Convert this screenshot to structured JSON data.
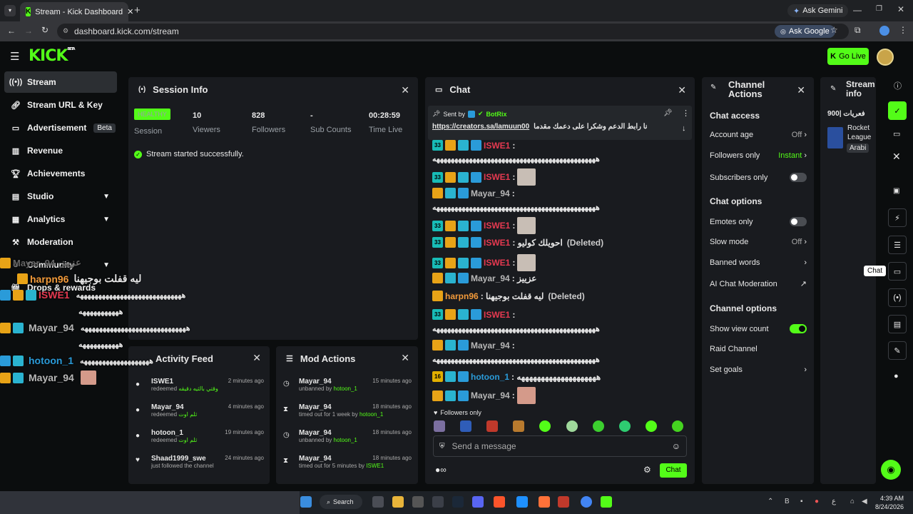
{
  "browser": {
    "tab_title": "Stream - Kick Dashboard",
    "ask_gemini": "Ask Gemini",
    "url": "dashboard.kick.com/stream",
    "ask_google": "Ask Google"
  },
  "header": {
    "logo": "KICK",
    "logo_beta": "BETA",
    "go_live": "Go Live"
  },
  "sidebar": {
    "items": [
      {
        "label": "Stream",
        "icon": "broadcast-icon"
      },
      {
        "label": "Stream URL & Key",
        "icon": "link-icon"
      },
      {
        "label": "Advertisement",
        "icon": "ad-icon",
        "badge": "Beta"
      },
      {
        "label": "Revenue",
        "icon": "chart-icon"
      },
      {
        "label": "Achievements",
        "icon": "trophy-icon"
      },
      {
        "label": "Studio",
        "icon": "studio-icon"
      },
      {
        "label": "Analytics",
        "icon": "analytics-icon"
      },
      {
        "label": "Moderation",
        "icon": "hammer-icon"
      },
      {
        "label": "Community",
        "icon": "community-icon"
      },
      {
        "label": "Drops & rewards",
        "icon": "gift-icon"
      }
    ]
  },
  "session": {
    "title": "Session Info",
    "status": "HEALTHY",
    "status_label": "Session",
    "viewers": "10",
    "viewers_label": "Viewers",
    "followers": "828",
    "followers_label": "Followers",
    "subs": "-",
    "subs_label": "Sub Counts",
    "time": "00:28:59",
    "time_label": "Time Live",
    "message": "Stream started successfully."
  },
  "chat": {
    "title": "Chat",
    "pinned_sent_by": "Sent by",
    "pinned_user": "BotRix",
    "pinned_link": "https://creators.sa/lamuun00",
    "pinned_text": "نا رابط الدعم وشكرا على دعمك مقدما",
    "rows": [
      {
        "user": "ISWE1",
        "text": ":"
      },
      {
        "user": "ISWE1",
        "text": ":"
      },
      {
        "user": "Mayar_94",
        "text": ":"
      },
      {
        "user": "ISWE1",
        "text": ":"
      },
      {
        "user": "ISWE1",
        "text": ": احويلك كوليو",
        "deleted": "(Deleted)"
      },
      {
        "user": "ISWE1",
        "text": ":"
      },
      {
        "user": "Mayar_94",
        "text": ": عزييز"
      },
      {
        "user": "harpn96",
        "text": ": ليه قفلت بوجيهنا",
        "deleted": "(Deleted)"
      },
      {
        "user": "ISWE1",
        "text": ":"
      },
      {
        "user": "Mayar_94",
        "text": ":"
      },
      {
        "user": "hotoon_1",
        "text": ": ههههههههههههههههههههه"
      },
      {
        "user": "Mayar_94",
        "text": ":"
      }
    ],
    "long_laugh": "هههههههههههههههههههههههههههههههههههههههههههههه",
    "followers_only": "Followers only",
    "input_placeholder": "Send a message",
    "send_label": "Chat",
    "tooltip": "Chat"
  },
  "channel_actions": {
    "title": "Channel Actions",
    "chat_access": "Chat access",
    "account_age": "Account age",
    "account_age_value": "Off",
    "followers_only": "Followers only",
    "followers_only_value": "Instant",
    "subscribers_only": "Subscribers only",
    "chat_options": "Chat options",
    "emotes_only": "Emotes only",
    "slow_mode": "Slow mode",
    "slow_mode_value": "Off",
    "banned_words": "Banned words",
    "ai_chat_moderation": "AI Chat Moderation",
    "channel_options": "Channel options",
    "show_view_count": "Show view count",
    "raid_channel": "Raid Channel",
    "set_goals": "Set goals"
  },
  "stream_info": {
    "title": "Stream info",
    "stream_title": "فعريات |900",
    "game": "Rocket League",
    "language": "Arabi"
  },
  "activity": {
    "title": "Activity Feed",
    "items": [
      {
        "user": "ISWE1",
        "time": "2 minutes ago",
        "action": "redeemed",
        "detail": "وقتي بالثيه دقيقه"
      },
      {
        "user": "Mayar_94",
        "time": "4 minutes ago",
        "action": "redeemed",
        "detail": "ثلم اوت"
      },
      {
        "user": "hotoon_1",
        "time": "19 minutes ago",
        "action": "redeemed",
        "detail": "ثلم اوت"
      },
      {
        "user": "Shaad1999_swe",
        "time": "24 minutes ago",
        "action": "just followed the channel",
        "detail": ""
      }
    ]
  },
  "mod_actions": {
    "title": "Mod Actions",
    "items": [
      {
        "user": "Mayar_94",
        "time": "15 minutes ago",
        "action": "unbanned by",
        "by": "hotoon_1"
      },
      {
        "user": "Mayar_94",
        "time": "18 minutes ago",
        "action": "timed out for 1 week by",
        "by": "hotoon_1"
      },
      {
        "user": "Mayar_94",
        "time": "18 minutes ago",
        "action": "unbanned by",
        "by": "hotoon_1"
      },
      {
        "user": "Mayar_94",
        "time": "18 minutes ago",
        "action": "timed out for 5 minutes by",
        "by": "ISWE1"
      }
    ]
  },
  "overlay": {
    "rows": [
      {
        "user": "Mayar_94",
        "text": "عزييز"
      },
      {
        "user": "harpn96",
        "text": "ليه قفلت بوجيهنا"
      },
      {
        "user": "ISWE1",
        "text": "هههههههههههههههههههههههههههههه"
      },
      {
        "user": "",
        "text": "هههههههههههه"
      },
      {
        "user": "Mayar_94",
        "text": "هههههههههههههههههههههههههههههه"
      },
      {
        "user": "",
        "text": "هههههههههههه"
      },
      {
        "user": "hotoon_1",
        "text": "هههههههههههههههههههه"
      },
      {
        "user": "Mayar_94",
        "text": ""
      }
    ]
  },
  "taskbar": {
    "search": "Search",
    "time": "4:39 AM",
    "date": "8/24/2026"
  },
  "colors": {
    "brand": "#53fc18",
    "panel": "#191b1f",
    "background": "#0b0d0e"
  }
}
